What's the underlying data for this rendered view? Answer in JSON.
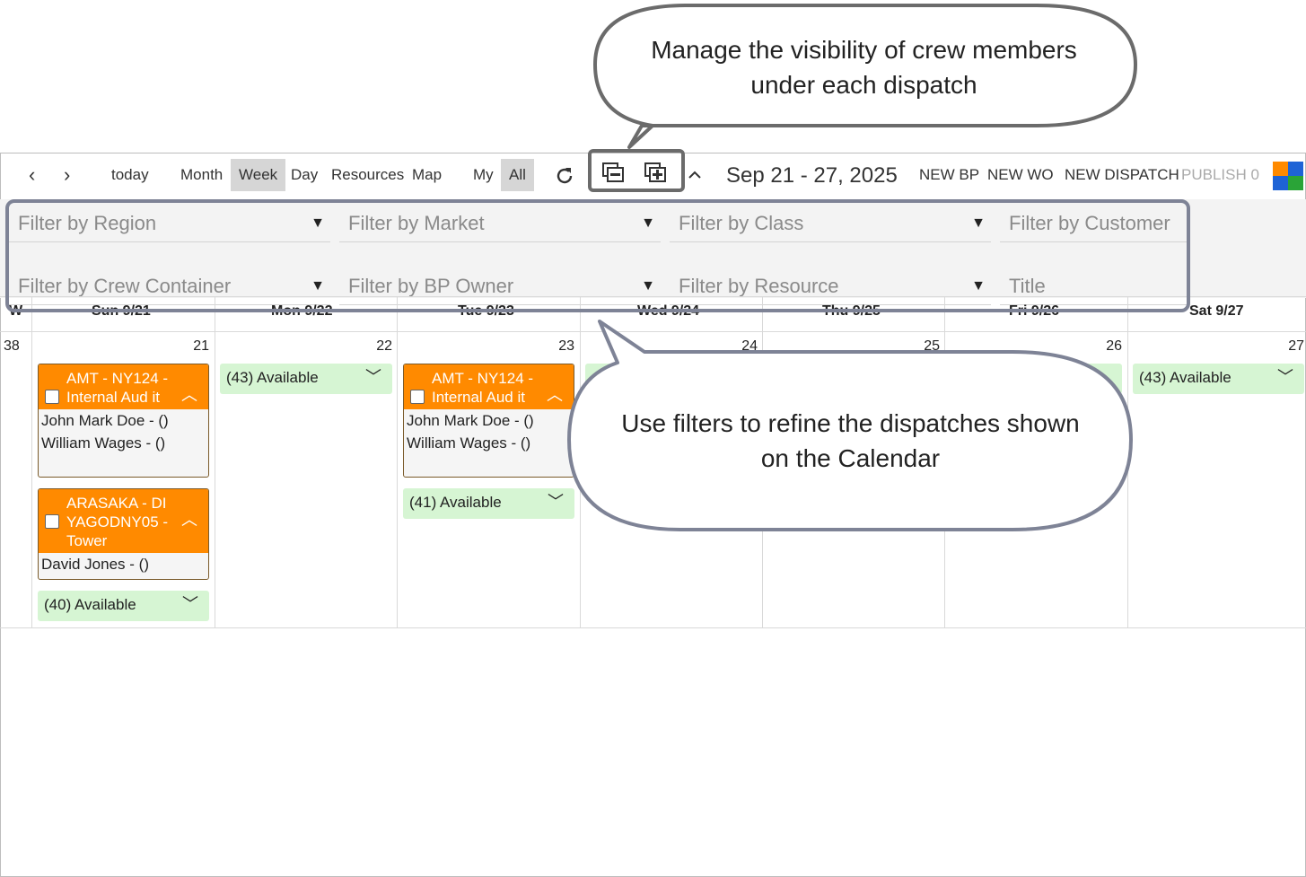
{
  "toolbar": {
    "prev": "‹",
    "next": "›",
    "today": "today",
    "views": [
      "Month",
      "Week",
      "Day",
      "Resources",
      "Map"
    ],
    "scope": [
      "My",
      "All"
    ],
    "date_range": "Sep 21 - 27, 2025",
    "new_bp": "NEW BP",
    "new_wo": "NEW WO",
    "new_dispatch": "NEW DISPATCH",
    "publish": "PUBLISH 0"
  },
  "filters": {
    "region": "Filter by Region",
    "market": "Filter by Market",
    "class": "Filter by Class",
    "customer": "Filter by Customer",
    "crew_container": "Filter by Crew Container",
    "bp_owner": "Filter by BP Owner",
    "resource": "Filter by Resource",
    "title": "Title"
  },
  "calendar": {
    "week_col": "W",
    "headers": [
      "Sun 9/21",
      "Mon 9/22",
      "Tue 9/23",
      "Wed 9/24",
      "Thu 9/25",
      "Fri 9/26",
      "Sat 9/27"
    ],
    "week_number": "38",
    "day_numbers": [
      "21",
      "22",
      "23",
      "24",
      "25",
      "26",
      "27"
    ],
    "sun": {
      "dispatch1": {
        "title": "AMT - NY124 - Internal Aud it",
        "crew": [
          "John Mark Doe - ()",
          "William Wages - ()"
        ]
      },
      "dispatch2": {
        "title": "ARASAKA - DI YAGODNY05 - Tower",
        "crew": [
          "David Jones - ()"
        ]
      },
      "available": "(40) Available"
    },
    "mon": {
      "available": "(43) Available"
    },
    "tue": {
      "dispatch1": {
        "title": "AMT - NY124 - Internal Aud it",
        "crew": [
          "John Mark Doe - ()",
          "William Wages - ()"
        ]
      },
      "available": "(41) Available"
    },
    "sat": {
      "available": "(43) Available"
    }
  },
  "callouts": {
    "top": "Manage the visibility of crew members under each dispatch",
    "bottom": "Use filters to refine the dispatches shown on the Calendar"
  },
  "colors": {
    "dispatch": "#ff8a00",
    "available": "#d6f5d3",
    "callout_border": "#7e8396"
  }
}
